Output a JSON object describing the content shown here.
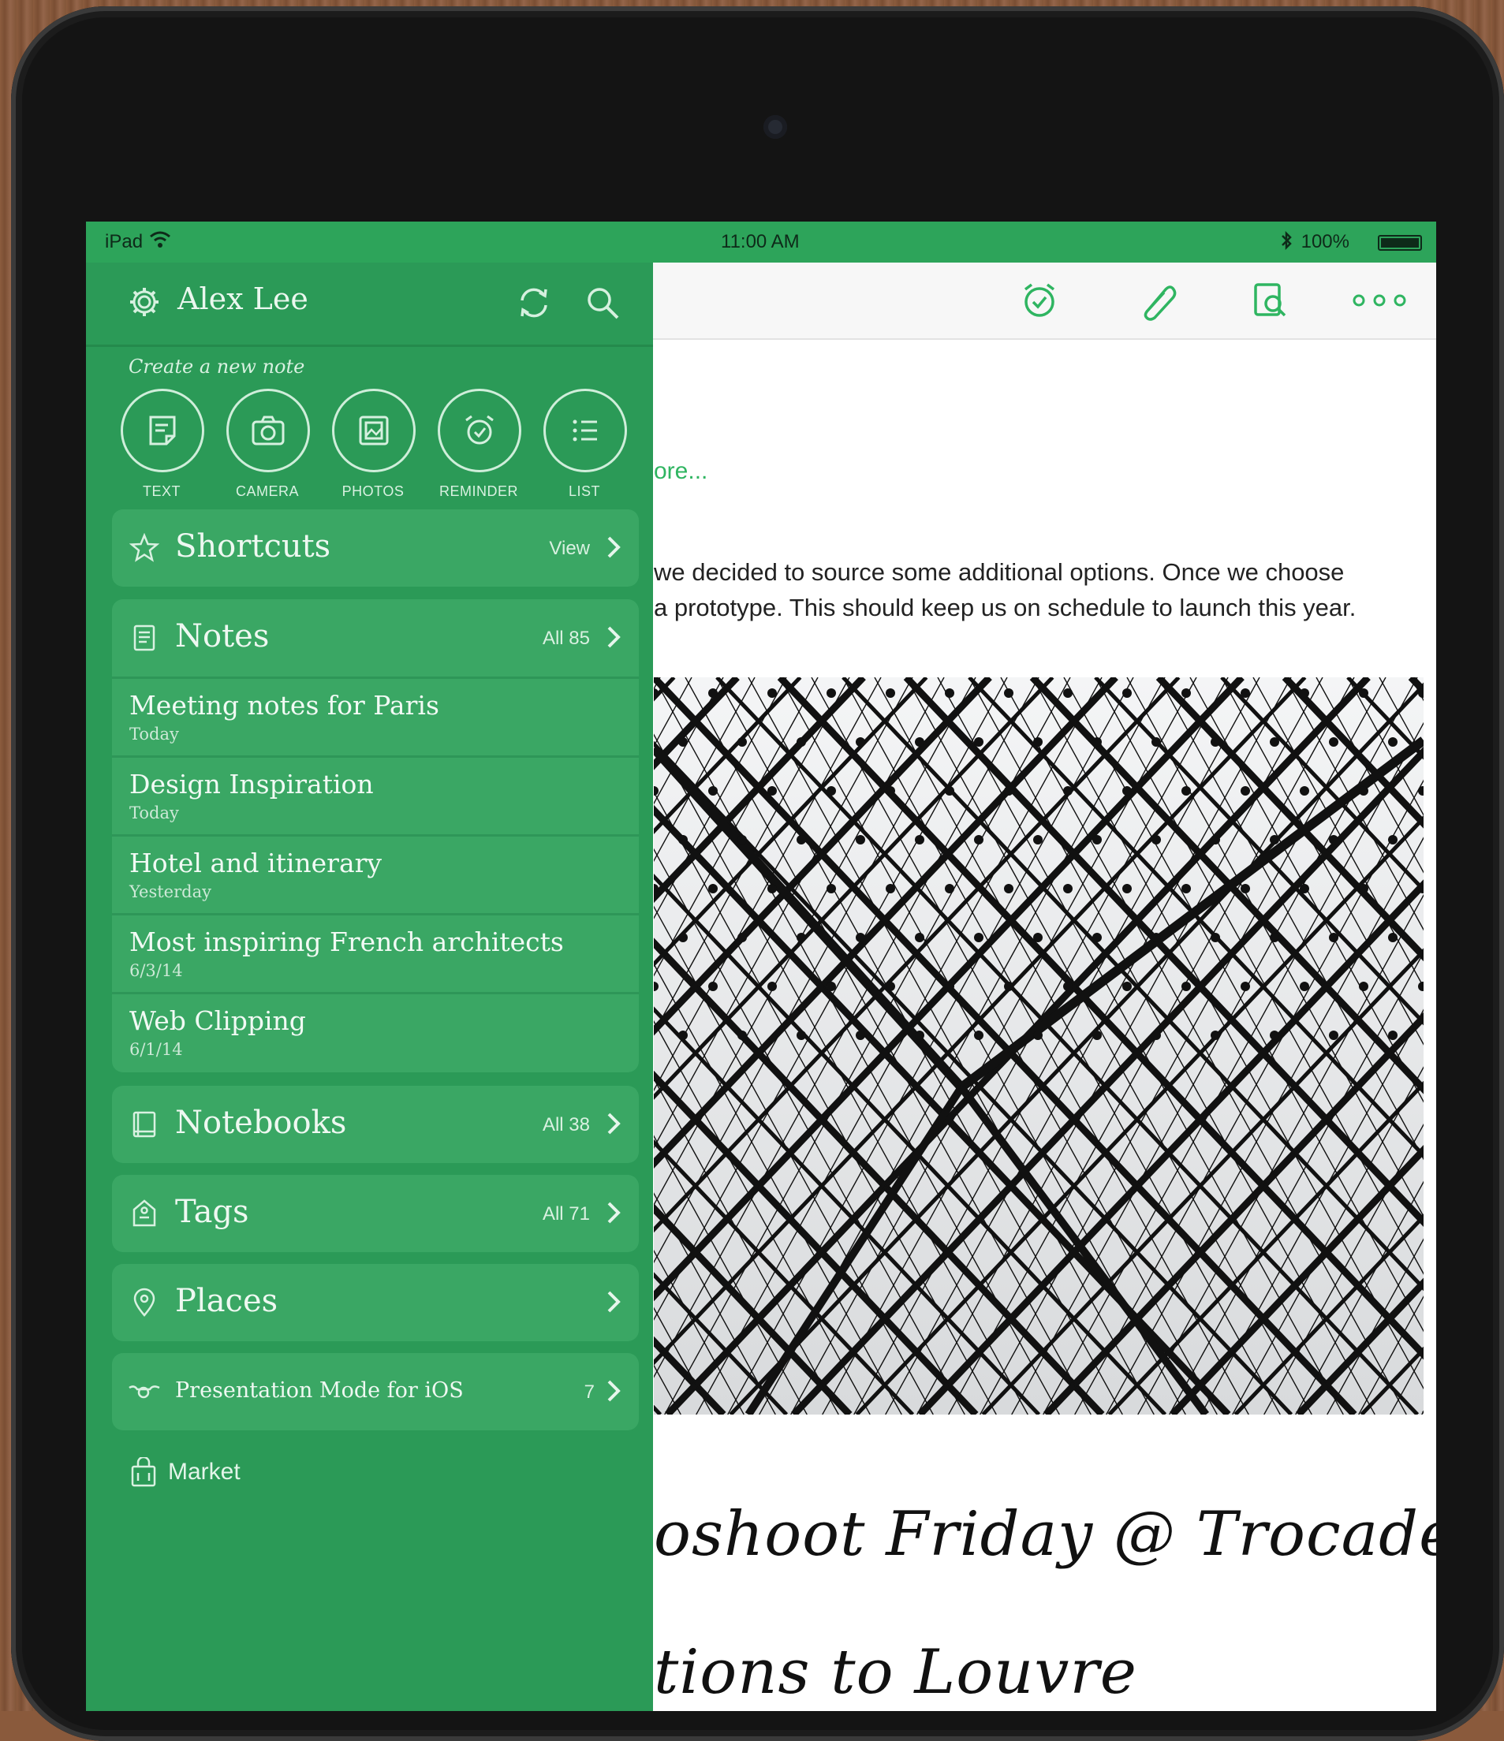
{
  "status_bar": {
    "carrier": "iPad",
    "time": "11:00 AM",
    "battery": "100%"
  },
  "note": {
    "more_link": "ore...",
    "text_line_1": "we decided to source some additional options. Once we choose",
    "text_line_2": "a prototype. This should keep us on schedule to launch this year.",
    "handwriting_line_1": "oshoot Friday @ Trocadero",
    "handwriting_line_2": "tions to Louvre"
  },
  "sidebar": {
    "user_name": "Alex Lee",
    "create_label": "Create a new note",
    "create_buttons": [
      {
        "label": "TEXT",
        "icon": "text-note-icon"
      },
      {
        "label": "CAMERA",
        "icon": "camera-icon"
      },
      {
        "label": "PHOTOS",
        "icon": "photos-icon"
      },
      {
        "label": "REMINDER",
        "icon": "alarm-clock-icon"
      },
      {
        "label": "LIST",
        "icon": "list-icon"
      }
    ],
    "shortcuts": {
      "title": "Shortcuts",
      "action": "View"
    },
    "notes": {
      "title": "Notes",
      "count": "All 85",
      "items": [
        {
          "title": "Meeting notes for Paris",
          "date": "Today"
        },
        {
          "title": "Design Inspiration",
          "date": "Today"
        },
        {
          "title": "Hotel and itinerary",
          "date": "Yesterday"
        },
        {
          "title": "Most inspiring French architects",
          "date": "6/3/14"
        },
        {
          "title": "Web Clipping",
          "date": "6/1/14"
        }
      ]
    },
    "notebooks": {
      "title": "Notebooks",
      "count": "All 38"
    },
    "tags": {
      "title": "Tags",
      "count": "All 71"
    },
    "places": {
      "title": "Places"
    },
    "presentation": {
      "title": "Presentation Mode for iOS",
      "count": "7"
    },
    "market": {
      "title": "Market"
    }
  },
  "colors": {
    "sidebar": "#2b9a57",
    "section": "#3aa764",
    "accent": "#2fb561"
  }
}
